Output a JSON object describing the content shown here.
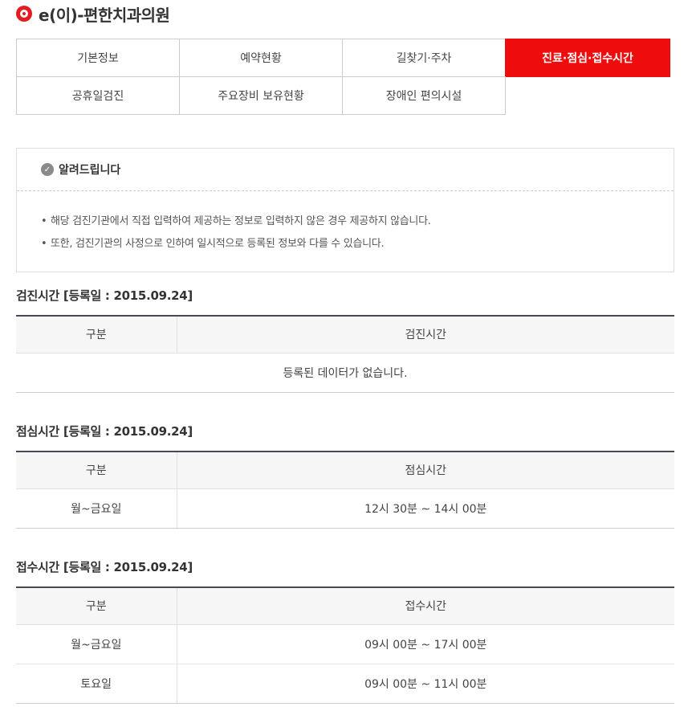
{
  "header": {
    "title": "e(이)-편한치과의원"
  },
  "tabs": {
    "row1": [
      "기본정보",
      "예약현황",
      "길찾기·주차",
      "진료·점심·접수시간"
    ],
    "row2": [
      "공휴일검진",
      "주요장비 보유현황",
      "장애인 편의시설"
    ],
    "active": "진료·점심·접수시간",
    "active_color": "#ee0c0c"
  },
  "notice": {
    "title": "알려드립니다",
    "items": [
      "해당 검진기관에서 직접 입력하여 제공하는 정보로 입력하지 않은 경우 제공하지 않습니다.",
      "또한, 검진기관의 사정으로 인하여 일시적으로 등록된 정보와 다를 수 있습니다."
    ]
  },
  "sections": {
    "checkup": {
      "title": "검진시간 [등록일 : 2015.09.24]",
      "col1": "구분",
      "col2": "검진시간",
      "empty": "등록된 데이터가 없습니다."
    },
    "lunch": {
      "title": "점심시간 [등록일 : 2015.09.24]",
      "col1": "구분",
      "col2": "점심시간",
      "rows": [
        {
          "label": "월~금요일",
          "time": "12시 30분 ~ 14시 00분"
        }
      ]
    },
    "reception": {
      "title": "접수시간 [등록일 : 2015.09.24]",
      "col1": "구분",
      "col2": "접수시간",
      "rows": [
        {
          "label": "월~금요일",
          "time": "09시 00분 ~ 17시 00분"
        },
        {
          "label": "토요일",
          "time": "09시 00분 ~ 11시 00분"
        }
      ]
    }
  }
}
